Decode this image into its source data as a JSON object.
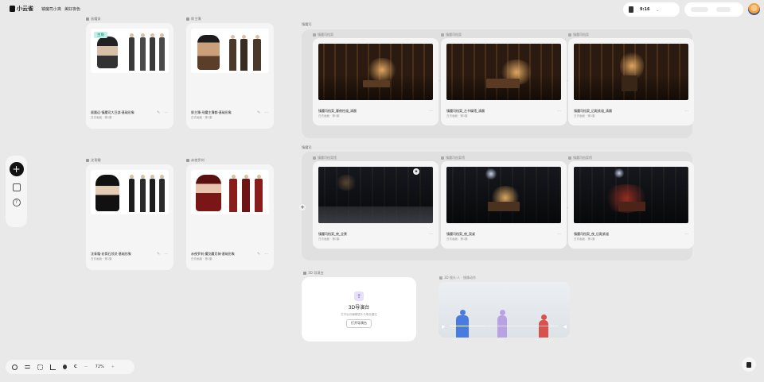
{
  "app": {
    "name": "小云雀",
    "breadcrumb": [
      "镇魔司小爽",
      "美好夜色"
    ]
  },
  "header": {
    "clip_time": "9:16",
    "right_btn_1": "",
    "right_btn_2": ""
  },
  "canvas": {
    "zoom": "72%"
  },
  "characters": [
    {
      "section": "画魔录",
      "tag": "主角",
      "title": "顾晨远-镇魔司大豆部-基础形象",
      "sub": "白衣画痕 · 第1集"
    },
    {
      "section": "胖主簿",
      "title": "胖主簿-刑魔主簿都-基础形象",
      "sub": "白衣画痕 · 第1集"
    },
    {
      "section": "沈青霜",
      "title": "沈青霜-花骨石领灵-基础形象",
      "sub": "白衣画痕 · 第1集"
    },
    {
      "section": "赤夜罗刹",
      "title": "赤夜罗刹-魔剑魔尼骑-基础形象",
      "sub": "白衣画痕 · 第1集"
    }
  ],
  "scene_groups": [
    {
      "label": "镇魔司",
      "scenes": [
        {
          "label": "镇魔司档案",
          "title": "镇魔司档案_暮夜柱道_清晨",
          "sub": "白衣画痕 · 第1集"
        },
        {
          "label": "镇魔司档案",
          "title": "镇魔司档案_左书碟馆_清晨",
          "sub": "白衣画痕 · 第1集"
        },
        {
          "label": "镇魔司档案",
          "title": "镇魔司档案_后殿紧道_清晨",
          "sub": "白衣画痕 · 第1集"
        }
      ]
    },
    {
      "label": "镇魔司",
      "scenes": [
        {
          "label": "镇魔司档案馆",
          "title": "镇魔司档案_夜_全景",
          "sub": "白衣画痕 · 第1集"
        },
        {
          "label": "镇魔司档案馆",
          "title": "镇魔司档案_夜_案桌",
          "sub": "白衣画痕 · 第1集"
        },
        {
          "label": "镇魔司档案馆",
          "title": "镇魔司档案_夜_后殿紧道",
          "sub": "白衣画痕 · 第1集"
        }
      ]
    }
  ],
  "stage": {
    "section": "3D 导演台",
    "title": "3D导演台",
    "desc": "打开后可编辑镜头与角色摆位",
    "button": "打开导演台"
  },
  "video": {
    "section": "3D 镜头·人 · 镜像动作",
    "progress": 0.32
  },
  "colors": {
    "accent": "#7a5cd6",
    "tag_bg": "#bff1e8",
    "figure_blue": "#4a7be0",
    "figure_purple": "#b9a2e4",
    "figure_red": "#d8514a"
  }
}
